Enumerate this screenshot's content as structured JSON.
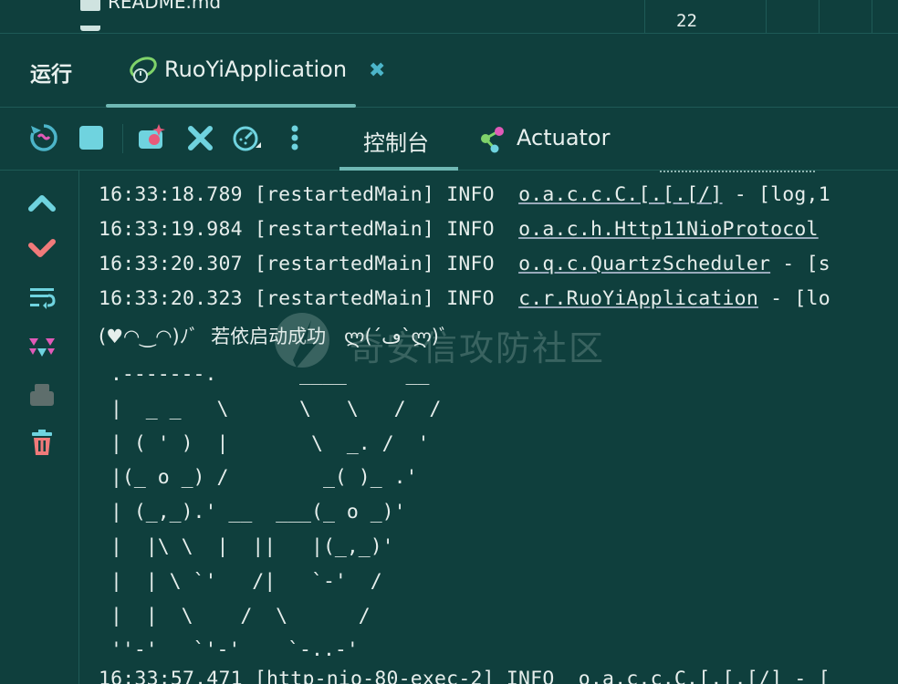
{
  "editor": {
    "file_name": "README.md",
    "line_number": "22"
  },
  "run_panel": {
    "title": "运行",
    "active_tab": "RuoYiApplication"
  },
  "console_tabs": {
    "console": "控制台",
    "actuator": "Actuator"
  },
  "toolbar_icons": [
    "rerun-icon",
    "stop-icon",
    "screenshot-icon",
    "close-icon",
    "profiler-icon",
    "more-icon"
  ],
  "sidebar_icons": [
    "scroll-up-icon",
    "scroll-down-icon",
    "soft-wrap-icon",
    "filter-icon",
    "print-icon",
    "trash-icon"
  ],
  "log_lines": [
    {
      "time": "16:33:18.789",
      "thread": "[restartedMain]",
      "level": "INFO",
      "logger": "o.a.c.c.C.[.[.[/]",
      "msg": " - [log,1"
    },
    {
      "time": "16:33:19.984",
      "thread": "[restartedMain]",
      "level": "INFO",
      "logger": "o.a.c.h.Http11NioProtocol",
      "msg": " "
    },
    {
      "time": "16:33:20.307",
      "thread": "[restartedMain]",
      "level": "INFO",
      "logger": "o.q.c.QuartzScheduler",
      "msg": " - [s"
    },
    {
      "time": "16:33:20.323",
      "thread": "[restartedMain]",
      "level": "INFO",
      "logger": "c.r.RuoYiApplication",
      "msg": " - [lo"
    }
  ],
  "startup_message": "(♥◠‿◠)ﾉﾞ  若依启动成功   ლ(´ڡ`ლ)ﾞ",
  "watermark": "奇安信攻防社区",
  "ascii_art": " .-------.       ____     __\n |  _ _   \\      \\   \\   /  /\n | ( ' )  |       \\  _. /  '\n |(_ o _) /        _( )_ .'\n | (_,_).' __  ___(_ o _)'\n |  |\\ \\  |  ||   |(_,_)'\n |  | \\ `'   /|   `-'  /\n |  |  \\    /  \\      /\n ''-'   `'-'    `-..-'",
  "last_line": "16:33:57.471 [http-nio-80-exec-2] INFO  o.a.c.c.C.[.[.[/] - [",
  "colors": {
    "background": "#0f3f3d",
    "accent": "#6fb8b4",
    "text": "#e6eeec",
    "close": "#4cb5c9"
  }
}
